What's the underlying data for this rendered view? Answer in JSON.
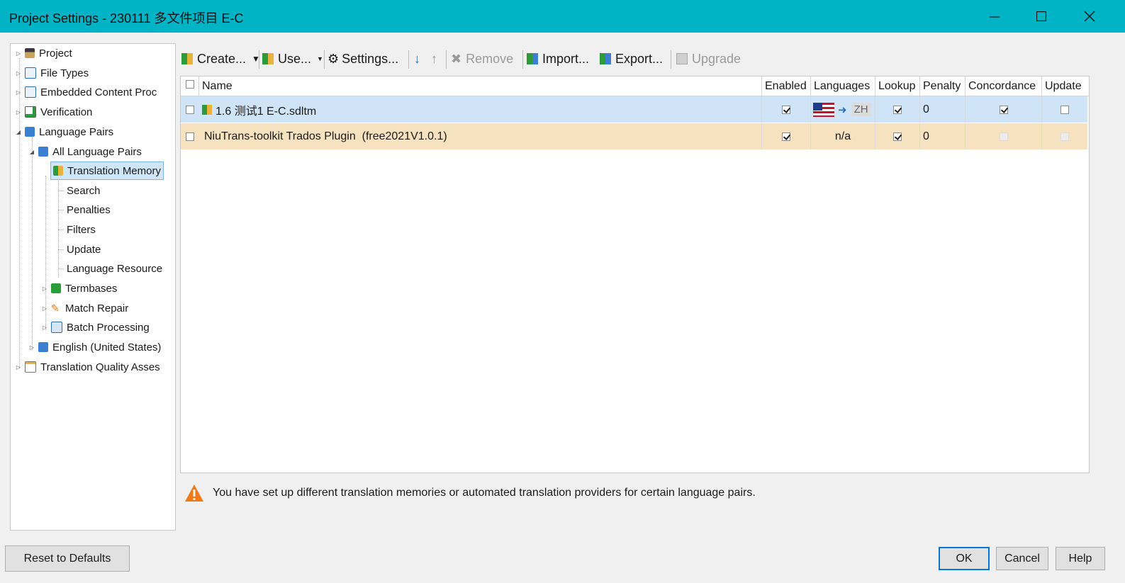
{
  "window": {
    "title": "Project Settings - 230111 多文件项目 E-C"
  },
  "tree": {
    "items": [
      {
        "label": "Project",
        "icon": "project-icon"
      },
      {
        "label": "File Types",
        "icon": "file-types-icon"
      },
      {
        "label": "Embedded Content Proc",
        "icon": "embedded-content-icon"
      },
      {
        "label": "Verification",
        "icon": "verification-icon"
      },
      {
        "label": "Language Pairs",
        "icon": "language-pairs-icon"
      },
      {
        "label": "All Language Pairs",
        "icon": "language-pairs-icon"
      },
      {
        "label": "Translation Memory",
        "icon": "translation-memory-icon"
      },
      {
        "label": "Search"
      },
      {
        "label": "Penalties"
      },
      {
        "label": "Filters"
      },
      {
        "label": "Update"
      },
      {
        "label": "Language Resource"
      },
      {
        "label": "Termbases",
        "icon": "termbase-icon"
      },
      {
        "label": "Match Repair",
        "icon": "wrench-icon"
      },
      {
        "label": "Batch Processing",
        "icon": "batch-icon"
      },
      {
        "label": "English (United States)",
        "icon": "language-pairs-icon"
      },
      {
        "label": "Translation Quality Asses",
        "icon": "quality-icon"
      }
    ]
  },
  "toolbar": {
    "create": "Create...",
    "use": "Use...",
    "settings": "Settings...",
    "remove": "Remove",
    "import": "Import...",
    "export": "Export...",
    "upgrade": "Upgrade"
  },
  "grid": {
    "columns": [
      "Name",
      "Enabled",
      "Languages",
      "Lookup",
      "Penalty",
      "Concordance",
      "Update"
    ],
    "rows": [
      {
        "name": "1.6 测试1 E-C.sdltm",
        "enabled": true,
        "languages_target": "ZH",
        "lookup": true,
        "penalty": "0",
        "concordance": true,
        "update": false
      },
      {
        "name": "NiuTrans-toolkit Trados Plugin  (free2021V1.0.1)",
        "enabled": true,
        "languages": "n/a",
        "lookup": true,
        "penalty": "0",
        "concordance": false,
        "update": false
      }
    ]
  },
  "warning": {
    "message": "You have set up different translation memories or automated translation providers for certain language pairs."
  },
  "buttons": {
    "reset": "Reset to Defaults",
    "ok": "OK",
    "cancel": "Cancel",
    "help": "Help"
  },
  "colors": {
    "titlebar": "#00b4c6",
    "row_selected": "#cfe4f6",
    "row_provider": "#f6e2bf",
    "warning": "#f07a1a"
  }
}
